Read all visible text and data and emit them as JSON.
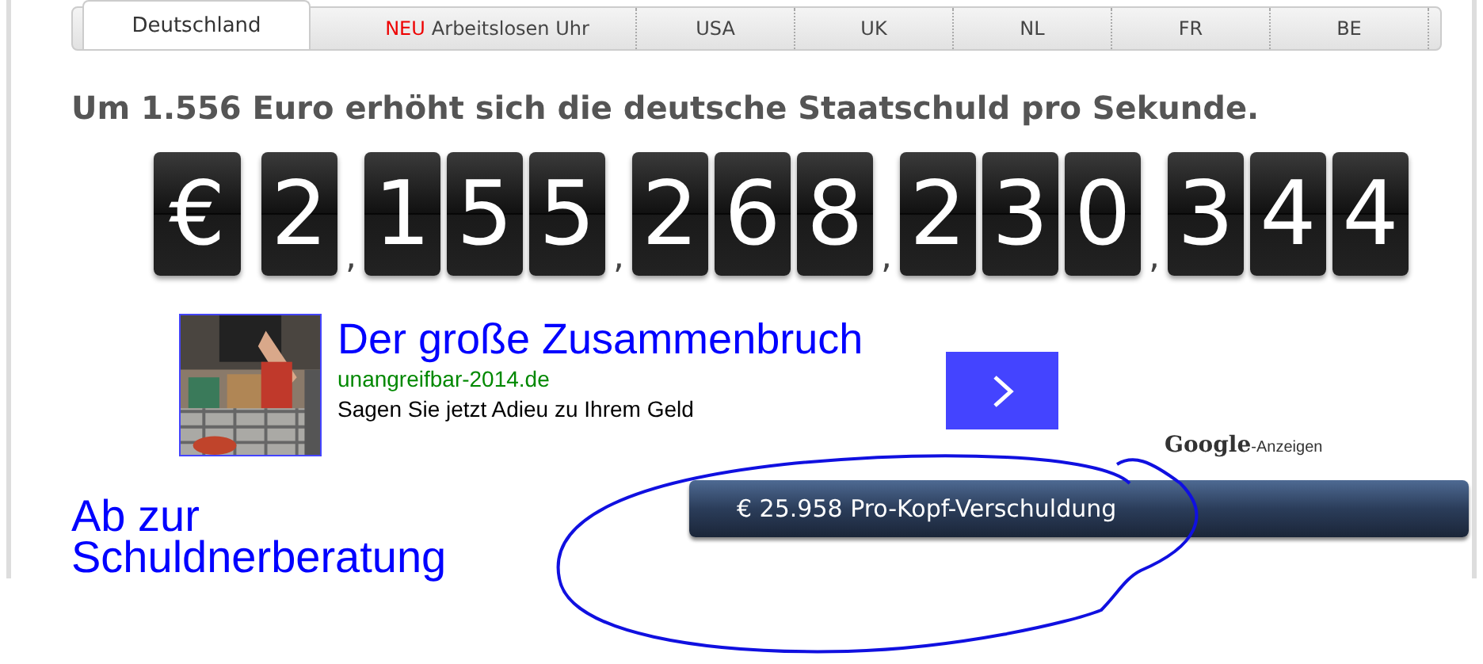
{
  "tabs": [
    {
      "label": "Deutschland",
      "selected": true
    },
    {
      "badge": "NEU",
      "label": "Arbeitslosen Uhr",
      "selected": false
    },
    {
      "label": "USA",
      "selected": false
    },
    {
      "label": "UK",
      "selected": false
    },
    {
      "label": "NL",
      "selected": false
    },
    {
      "label": "FR",
      "selected": false
    },
    {
      "label": "BE",
      "selected": false
    }
  ],
  "headline": "Um 1.556 Euro erhöht sich die deutsche Staatschuld pro Sekunde.",
  "counter": {
    "currency": "€",
    "separator": ",",
    "groups": [
      "2",
      "155",
      "268",
      "230",
      "344"
    ]
  },
  "ad": {
    "title": "Der große Zusammenbruch",
    "url": "unangreifbar-2014.de",
    "text": "Sagen Sie jetzt Adieu zu Ihrem Geld",
    "brand": "Google",
    "brand_suffix": "-Anzeigen"
  },
  "link": "Ab zur Schuldnerberatung",
  "per_capita_button": "€ 25.958 Pro-Kopf-Verschuldung"
}
